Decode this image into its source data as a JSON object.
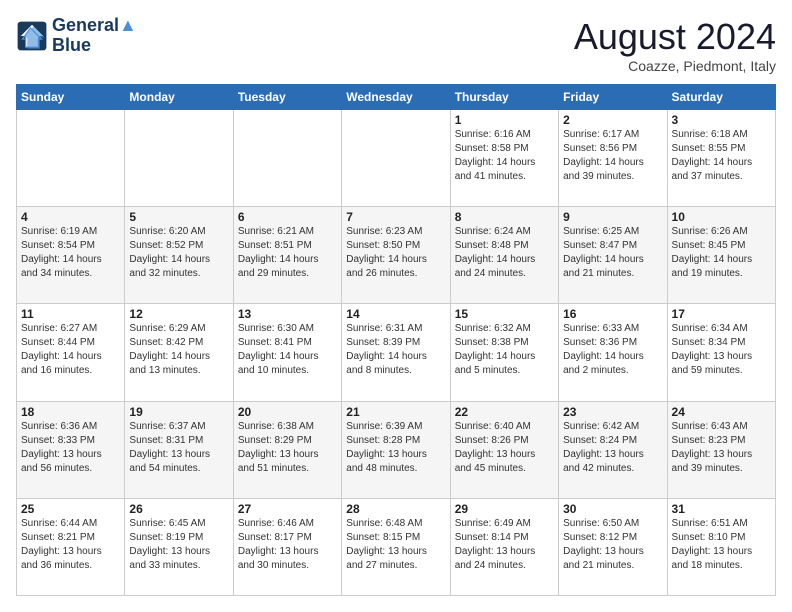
{
  "header": {
    "logo_line1": "General",
    "logo_line2": "Blue",
    "month_title": "August 2024",
    "subtitle": "Coazze, Piedmont, Italy"
  },
  "days_of_week": [
    "Sunday",
    "Monday",
    "Tuesday",
    "Wednesday",
    "Thursday",
    "Friday",
    "Saturday"
  ],
  "weeks": [
    [
      {
        "day": "",
        "info": ""
      },
      {
        "day": "",
        "info": ""
      },
      {
        "day": "",
        "info": ""
      },
      {
        "day": "",
        "info": ""
      },
      {
        "day": "1",
        "info": "Sunrise: 6:16 AM\nSunset: 8:58 PM\nDaylight: 14 hours and 41 minutes."
      },
      {
        "day": "2",
        "info": "Sunrise: 6:17 AM\nSunset: 8:56 PM\nDaylight: 14 hours and 39 minutes."
      },
      {
        "day": "3",
        "info": "Sunrise: 6:18 AM\nSunset: 8:55 PM\nDaylight: 14 hours and 37 minutes."
      }
    ],
    [
      {
        "day": "4",
        "info": "Sunrise: 6:19 AM\nSunset: 8:54 PM\nDaylight: 14 hours and 34 minutes."
      },
      {
        "day": "5",
        "info": "Sunrise: 6:20 AM\nSunset: 8:52 PM\nDaylight: 14 hours and 32 minutes."
      },
      {
        "day": "6",
        "info": "Sunrise: 6:21 AM\nSunset: 8:51 PM\nDaylight: 14 hours and 29 minutes."
      },
      {
        "day": "7",
        "info": "Sunrise: 6:23 AM\nSunset: 8:50 PM\nDaylight: 14 hours and 26 minutes."
      },
      {
        "day": "8",
        "info": "Sunrise: 6:24 AM\nSunset: 8:48 PM\nDaylight: 14 hours and 24 minutes."
      },
      {
        "day": "9",
        "info": "Sunrise: 6:25 AM\nSunset: 8:47 PM\nDaylight: 14 hours and 21 minutes."
      },
      {
        "day": "10",
        "info": "Sunrise: 6:26 AM\nSunset: 8:45 PM\nDaylight: 14 hours and 19 minutes."
      }
    ],
    [
      {
        "day": "11",
        "info": "Sunrise: 6:27 AM\nSunset: 8:44 PM\nDaylight: 14 hours and 16 minutes."
      },
      {
        "day": "12",
        "info": "Sunrise: 6:29 AM\nSunset: 8:42 PM\nDaylight: 14 hours and 13 minutes."
      },
      {
        "day": "13",
        "info": "Sunrise: 6:30 AM\nSunset: 8:41 PM\nDaylight: 14 hours and 10 minutes."
      },
      {
        "day": "14",
        "info": "Sunrise: 6:31 AM\nSunset: 8:39 PM\nDaylight: 14 hours and 8 minutes."
      },
      {
        "day": "15",
        "info": "Sunrise: 6:32 AM\nSunset: 8:38 PM\nDaylight: 14 hours and 5 minutes."
      },
      {
        "day": "16",
        "info": "Sunrise: 6:33 AM\nSunset: 8:36 PM\nDaylight: 14 hours and 2 minutes."
      },
      {
        "day": "17",
        "info": "Sunrise: 6:34 AM\nSunset: 8:34 PM\nDaylight: 13 hours and 59 minutes."
      }
    ],
    [
      {
        "day": "18",
        "info": "Sunrise: 6:36 AM\nSunset: 8:33 PM\nDaylight: 13 hours and 56 minutes."
      },
      {
        "day": "19",
        "info": "Sunrise: 6:37 AM\nSunset: 8:31 PM\nDaylight: 13 hours and 54 minutes."
      },
      {
        "day": "20",
        "info": "Sunrise: 6:38 AM\nSunset: 8:29 PM\nDaylight: 13 hours and 51 minutes."
      },
      {
        "day": "21",
        "info": "Sunrise: 6:39 AM\nSunset: 8:28 PM\nDaylight: 13 hours and 48 minutes."
      },
      {
        "day": "22",
        "info": "Sunrise: 6:40 AM\nSunset: 8:26 PM\nDaylight: 13 hours and 45 minutes."
      },
      {
        "day": "23",
        "info": "Sunrise: 6:42 AM\nSunset: 8:24 PM\nDaylight: 13 hours and 42 minutes."
      },
      {
        "day": "24",
        "info": "Sunrise: 6:43 AM\nSunset: 8:23 PM\nDaylight: 13 hours and 39 minutes."
      }
    ],
    [
      {
        "day": "25",
        "info": "Sunrise: 6:44 AM\nSunset: 8:21 PM\nDaylight: 13 hours and 36 minutes."
      },
      {
        "day": "26",
        "info": "Sunrise: 6:45 AM\nSunset: 8:19 PM\nDaylight: 13 hours and 33 minutes."
      },
      {
        "day": "27",
        "info": "Sunrise: 6:46 AM\nSunset: 8:17 PM\nDaylight: 13 hours and 30 minutes."
      },
      {
        "day": "28",
        "info": "Sunrise: 6:48 AM\nSunset: 8:15 PM\nDaylight: 13 hours and 27 minutes."
      },
      {
        "day": "29",
        "info": "Sunrise: 6:49 AM\nSunset: 8:14 PM\nDaylight: 13 hours and 24 minutes."
      },
      {
        "day": "30",
        "info": "Sunrise: 6:50 AM\nSunset: 8:12 PM\nDaylight: 13 hours and 21 minutes."
      },
      {
        "day": "31",
        "info": "Sunrise: 6:51 AM\nSunset: 8:10 PM\nDaylight: 13 hours and 18 minutes."
      }
    ]
  ]
}
